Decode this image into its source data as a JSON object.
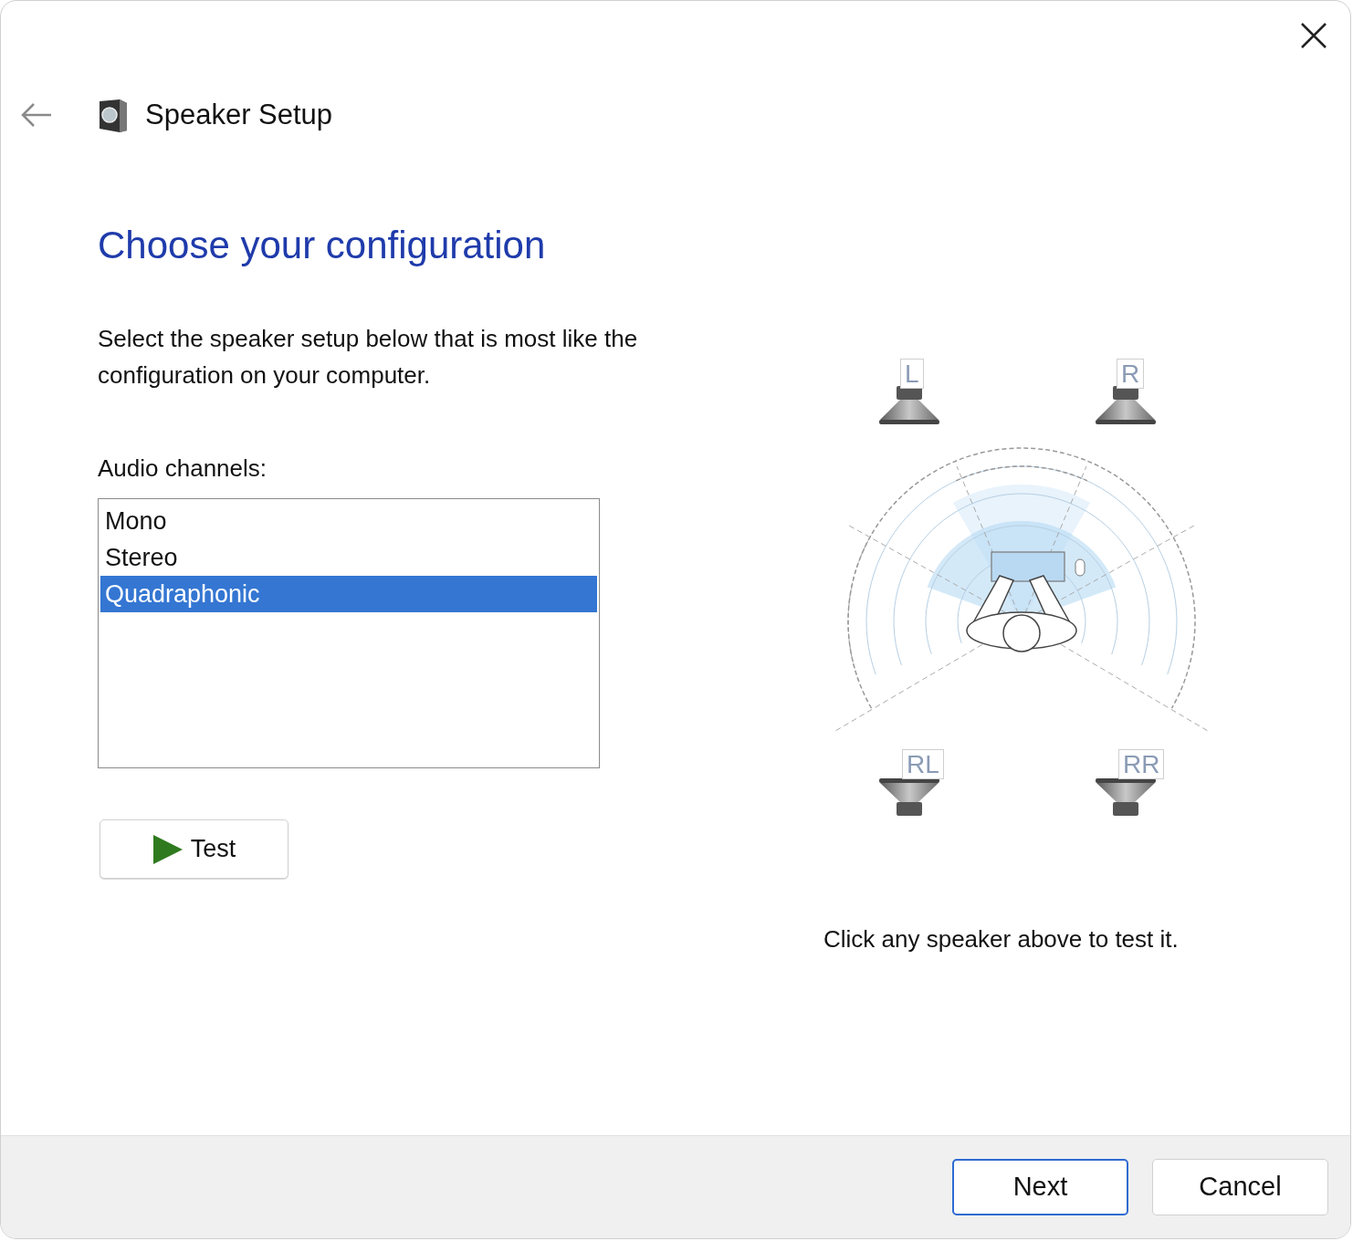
{
  "window": {
    "title": "Speaker Setup"
  },
  "heading": "Choose your configuration",
  "description": [
    "Select the speaker setup below that is most like the",
    "configuration on your computer."
  ],
  "channels_label": "Audio channels:",
  "channels": [
    {
      "label": "Mono",
      "selected": false
    },
    {
      "label": "Stereo",
      "selected": false
    },
    {
      "label": "Quadraphonic",
      "selected": true
    }
  ],
  "test_button": "Test",
  "speakers": [
    {
      "label": "L",
      "kind": "front"
    },
    {
      "label": "R",
      "kind": "front"
    },
    {
      "label": "RL",
      "kind": "rear"
    },
    {
      "label": "RR",
      "kind": "rear"
    }
  ],
  "caption": "Click any speaker above to test it.",
  "buttons": [
    {
      "label": "Next",
      "default": true
    },
    {
      "label": "Cancel",
      "default": false
    }
  ]
}
